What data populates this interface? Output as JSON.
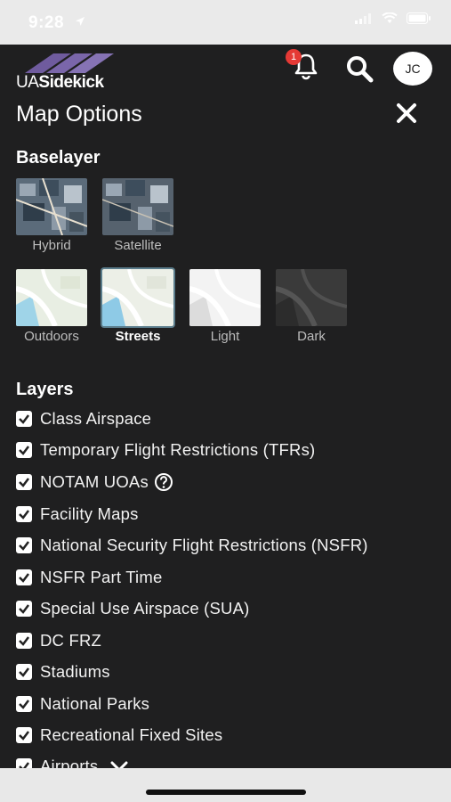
{
  "status": {
    "time": "9:28"
  },
  "header": {
    "logo_prefix": "UA",
    "logo_suffix": "Sidekick",
    "notification_count": "1",
    "avatar_initials": "JC"
  },
  "page": {
    "title": "Map Options"
  },
  "baselayer": {
    "title": "Baselayer",
    "options": [
      {
        "label": "Hybrid"
      },
      {
        "label": "Satellite"
      },
      {
        "label": "Outdoors"
      },
      {
        "label": "Streets"
      },
      {
        "label": "Light"
      },
      {
        "label": "Dark"
      }
    ],
    "selected": "Streets"
  },
  "layers": {
    "title": "Layers",
    "items": [
      {
        "label": "Class Airspace",
        "checked": true
      },
      {
        "label": "Temporary Flight Restrictions (TFRs)",
        "checked": true
      },
      {
        "label": "NOTAM UOAs",
        "checked": true
      },
      {
        "label": "Facility Maps",
        "checked": true
      },
      {
        "label": "National Security Flight Restrictions (NSFR)",
        "checked": true
      },
      {
        "label": "NSFR Part Time",
        "checked": true
      },
      {
        "label": "Special Use Airspace (SUA)",
        "checked": true
      },
      {
        "label": "DC FRZ",
        "checked": true
      },
      {
        "label": "Stadiums",
        "checked": true
      },
      {
        "label": "National Parks",
        "checked": true
      },
      {
        "label": "Recreational Fixed Sites",
        "checked": true
      },
      {
        "label": "Airports",
        "checked": true
      }
    ]
  },
  "colors": {
    "background": "#1f1f20",
    "badge": "#e53935",
    "text": "#ffffff",
    "muted": "#bdbdbd",
    "logo_stripes": "#6f5b9e"
  }
}
